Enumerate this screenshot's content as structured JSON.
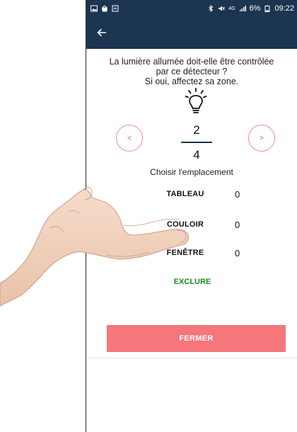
{
  "status_bar": {
    "left_icons": [
      "image-icon",
      "bag-icon",
      "screen-icon"
    ],
    "right_text": "✱ ★ ⁴ᴳ .ıl 6% ▮ 09:22",
    "signal": "4G",
    "battery": "6%",
    "time": "09:22"
  },
  "app_bar": {
    "back_icon": "arrow-left-icon"
  },
  "question": {
    "line1": "La lumière allumée doit-elle être contrôlée",
    "line2": "par ce détecteur ?",
    "line3": "Si oui, affectez sa zone."
  },
  "pager": {
    "prev_label": "<",
    "next_label": ">",
    "current": "2",
    "total": "4"
  },
  "choose_label": "Choisir l'emplacement",
  "zones": [
    {
      "name": "TABLEAU",
      "count": "0"
    },
    {
      "name": "COULOIR",
      "count": "0"
    },
    {
      "name": "FENÊTRE",
      "count": "0"
    }
  ],
  "exclude_label": "EXCLURE",
  "close_label": "FERMER",
  "colors": {
    "header": "#1c3550",
    "accent": "#f5767b",
    "accent_border": "#f28a8f",
    "exclude": "#228b22"
  }
}
